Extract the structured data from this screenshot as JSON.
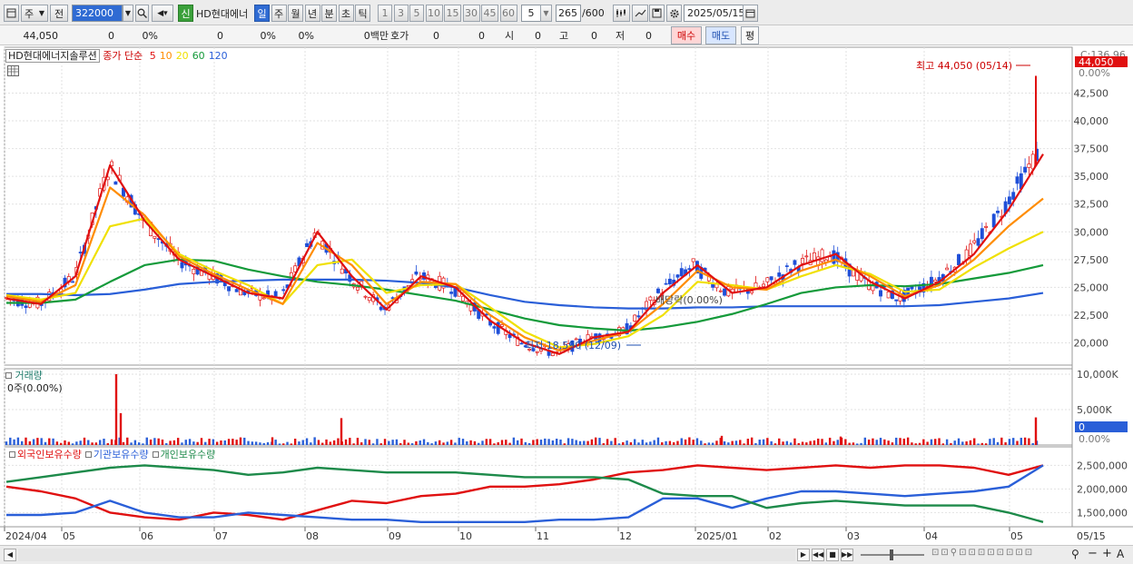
{
  "toolbar": {
    "type_label": "주",
    "prev_label": "전",
    "code_value": "322000",
    "new_label": "신",
    "stock_name": "HD현대에너",
    "periods": [
      {
        "label": "일",
        "active": true
      },
      {
        "label": "주",
        "active": false
      },
      {
        "label": "월",
        "active": false
      },
      {
        "label": "년",
        "active": false
      },
      {
        "label": "분",
        "active": false
      },
      {
        "label": "초",
        "active": false
      },
      {
        "label": "틱",
        "active": false
      }
    ],
    "intervals": [
      "1",
      "3",
      "5",
      "10",
      "15",
      "30",
      "45",
      "60"
    ],
    "interval_value": "5",
    "count_value": "265",
    "count_max": "/600",
    "date_value": "2025/05/15"
  },
  "quote": {
    "price": "44,050",
    "change": "0",
    "change_pct": "0%",
    "volume": "0",
    "vol_pct": "0%",
    "vol_pct2": "0%",
    "amount": "0백만",
    "bid_label": "호가",
    "bid1": "0",
    "bid2": "0",
    "open_label": "시",
    "open_value": "0",
    "high_label": "고",
    "high_value": "0",
    "low_label": "저",
    "low_value": "0",
    "buy_label": "매수",
    "sell_label": "매도",
    "eval_label": "평"
  },
  "legend": {
    "stock": "HD현대에너지솔루션",
    "ma_title": "종가 단순",
    "ma_periods": [
      "5",
      "10",
      "20",
      "60",
      "120"
    ],
    "ma_colors": [
      "#e01010",
      "#ff8c00",
      "#f0e000",
      "#149a3a",
      "#2a5fd8"
    ],
    "volume_title": "거래량",
    "volume_value": "0주(0.00%)",
    "holders": [
      "외국인보유수량",
      "기관보유수량",
      "개인보유수량"
    ],
    "holder_colors": [
      "#e01010",
      "#2a5fd8",
      "#1d8a4a"
    ]
  },
  "annotations": {
    "high": "최고 44,050 (05/14)",
    "low": "최저 18,590 (12/09)",
    "dividend": "배당락(0.00%)"
  },
  "price_axis": {
    "top_labels": [
      "C:136.96",
      "44,050",
      "0.00%"
    ],
    "ticks": [
      "42,500",
      "40,000",
      "37,500",
      "35,000",
      "32,500",
      "30,000",
      "27,500",
      "25,000",
      "22,500",
      "20,000"
    ]
  },
  "volume_axis": {
    "ticks": [
      "10,000K",
      "5,000K"
    ],
    "current": "0",
    "pct": "0.00%"
  },
  "holder_axis": {
    "ticks": [
      "2,500,000",
      "2,000,000",
      "1,500,000"
    ]
  },
  "date_axis": [
    "2024/04",
    "05",
    "06",
    "07",
    "08",
    "09",
    "10",
    "11",
    "12",
    "2025/01",
    "02",
    "03",
    "04",
    "05",
    "05/15"
  ],
  "chart_data": {
    "type": "line",
    "title": "HD현대에너지솔루션",
    "price_range": [
      18000,
      44500
    ],
    "months": [
      "2024/04",
      "05",
      "06",
      "07",
      "08",
      "09",
      "10",
      "11",
      "12",
      "2025/01",
      "02",
      "03",
      "04",
      "05"
    ],
    "series": [
      {
        "name": "5",
        "color": "#e01010",
        "values": [
          24000,
          23500,
          26000,
          36000,
          31000,
          27500,
          26000,
          24500,
          24000,
          30000,
          26000,
          23000,
          26000,
          25000,
          22000,
          20000,
          19000,
          20500,
          21000,
          24500,
          27000,
          24500,
          25000,
          27000,
          28000,
          25500,
          24000,
          25500,
          28000,
          32000,
          37000
        ]
      },
      {
        "name": "10",
        "color": "#ff8c00",
        "values": [
          24200,
          23700,
          25200,
          34000,
          31500,
          27800,
          26200,
          24800,
          23500,
          29000,
          27000,
          23500,
          25500,
          25300,
          22500,
          20500,
          19300,
          20200,
          21000,
          23500,
          26500,
          25000,
          24800,
          26500,
          27500,
          26000,
          24200,
          25200,
          27500,
          30500,
          33000
        ]
      },
      {
        "name": "20",
        "color": "#f0e000",
        "values": [
          24300,
          23900,
          24500,
          30500,
          31200,
          28000,
          26500,
          25200,
          23500,
          27000,
          27500,
          24500,
          25200,
          25300,
          23200,
          21000,
          19600,
          19900,
          20600,
          22500,
          25500,
          25200,
          24800,
          26000,
          27000,
          26200,
          24600,
          24800,
          26800,
          28500,
          30000
        ]
      },
      {
        "name": "60",
        "color": "#149a3a",
        "values": [
          23600,
          23600,
          23900,
          25500,
          27000,
          27500,
          27400,
          26600,
          26000,
          25500,
          25200,
          24800,
          24300,
          23800,
          23000,
          22200,
          21600,
          21300,
          21100,
          21400,
          21900,
          22600,
          23500,
          24500,
          25000,
          25200,
          25100,
          25300,
          25800,
          26300,
          27000
        ]
      },
      {
        "name": "120",
        "color": "#2a5fd8",
        "values": [
          24400,
          24400,
          24300,
          24400,
          24800,
          25300,
          25500,
          25600,
          25700,
          25700,
          25700,
          25600,
          25400,
          25000,
          24300,
          23700,
          23400,
          23200,
          23100,
          23100,
          23200,
          23200,
          23300,
          23300,
          23300,
          23300,
          23300,
          23400,
          23700,
          24000,
          24500
        ]
      }
    ],
    "volume_max": 10000000,
    "volume_spikes": [
      {
        "date": "2024/05/29",
        "value": 10000000
      },
      {
        "date": "2024/05/30",
        "value": 4500000
      },
      {
        "date": "2024/08/05",
        "value": 3800000
      },
      {
        "date": "2025/05/14",
        "value": 3900000
      }
    ],
    "holders_range": [
      1200000,
      2700000
    ],
    "holders": [
      {
        "name": "외국인보유수량",
        "values": [
          2050000,
          1950000,
          1800000,
          1500000,
          1400000,
          1350000,
          1500000,
          1450000,
          1350000,
          1550000,
          1750000,
          1700000,
          1850000,
          1900000,
          2050000,
          2050000,
          2100000,
          2200000,
          2350000,
          2400000,
          2500000,
          2450000,
          2400000,
          2450000,
          2500000,
          2450000,
          2500000,
          2500000,
          2450000,
          2300000,
          2500000
        ]
      },
      {
        "name": "기관보유수량",
        "values": [
          1450000,
          1450000,
          1500000,
          1750000,
          1500000,
          1400000,
          1400000,
          1500000,
          1450000,
          1400000,
          1350000,
          1350000,
          1300000,
          1300000,
          1300000,
          1300000,
          1350000,
          1350000,
          1400000,
          1800000,
          1800000,
          1600000,
          1800000,
          1950000,
          1950000,
          1900000,
          1850000,
          1900000,
          1950000,
          2050000,
          2500000
        ]
      },
      {
        "name": "개인보유수량",
        "values": [
          2150000,
          2250000,
          2350000,
          2450000,
          2500000,
          2450000,
          2400000,
          2300000,
          2350000,
          2450000,
          2400000,
          2350000,
          2350000,
          2350000,
          2300000,
          2250000,
          2250000,
          2250000,
          2200000,
          1900000,
          1850000,
          1850000,
          1600000,
          1700000,
          1750000,
          1700000,
          1650000,
          1650000,
          1650000,
          1500000,
          1300000
        ]
      }
    ]
  }
}
